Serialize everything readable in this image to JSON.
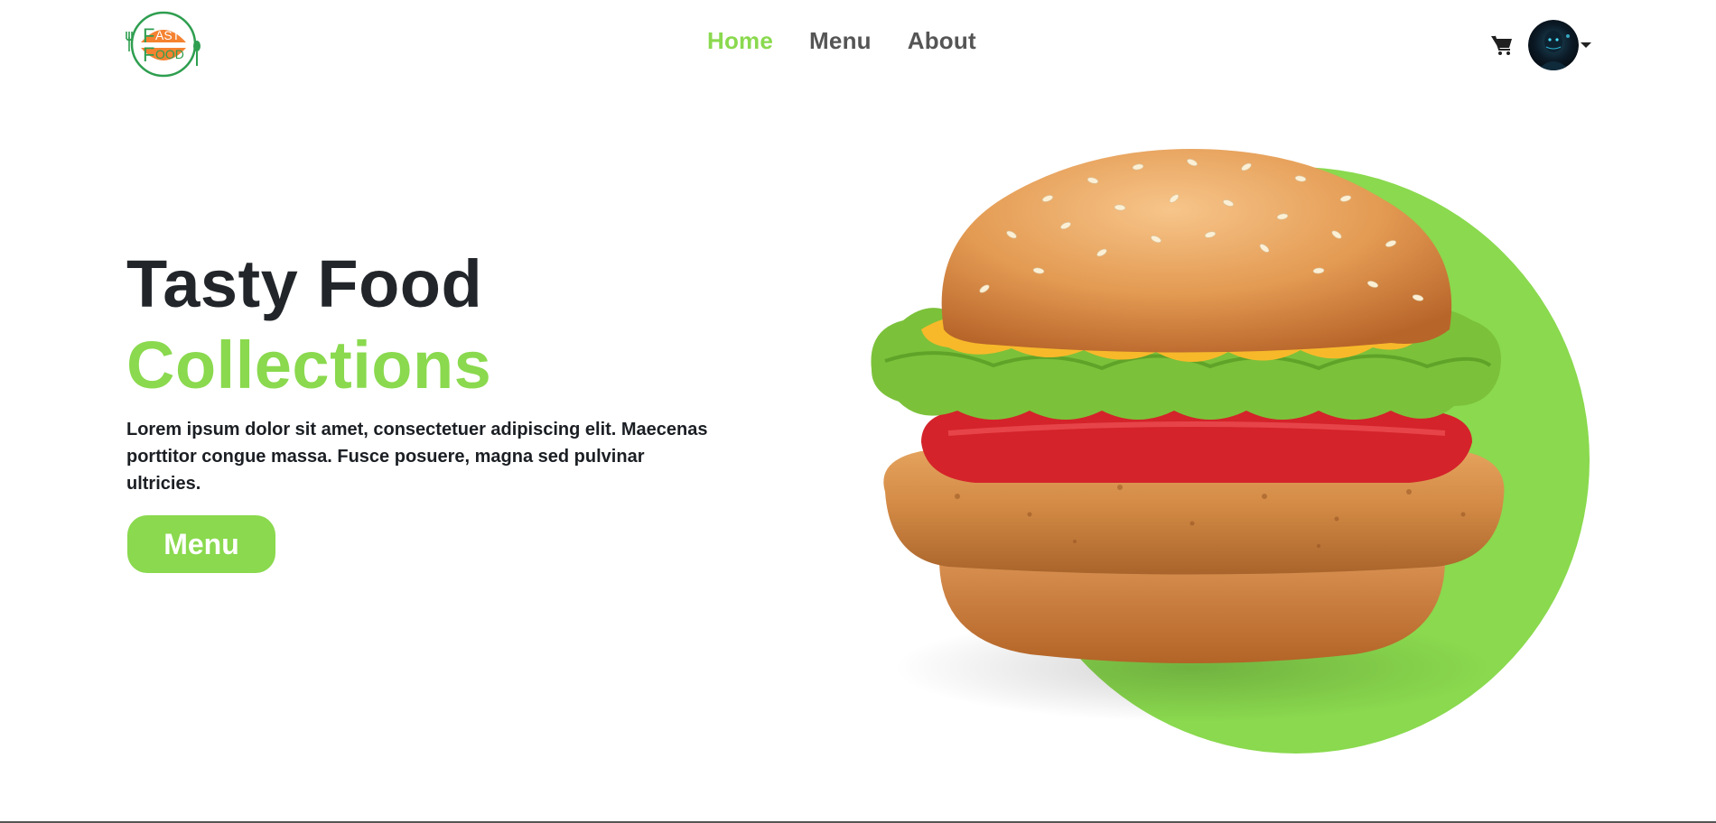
{
  "header": {
    "logo": {
      "line1": "AST",
      "line2": "OOD",
      "initial1": "F",
      "initial2": "F"
    },
    "nav": [
      {
        "label": "Home",
        "active": true
      },
      {
        "label": "Menu",
        "active": false
      },
      {
        "label": "About",
        "active": false
      }
    ],
    "cart_icon": "shopping-cart-icon",
    "avatar_icon": "user-avatar"
  },
  "hero": {
    "title_line1": "Tasty Food",
    "title_line2": "Collections",
    "description": "Lorem ipsum dolor sit amet, consectetuer adipiscing elit. Maecenas porttitor congue massa. Fusce posuere, magna sed pulvinar ultricies.",
    "button_label": "Menu",
    "image": "burger-illustration"
  },
  "colors": {
    "accent": "#8ad94e",
    "heading": "#22262a",
    "nav_text": "#555555",
    "logo_orange": "#f58230",
    "logo_green": "#2e9e4f"
  }
}
